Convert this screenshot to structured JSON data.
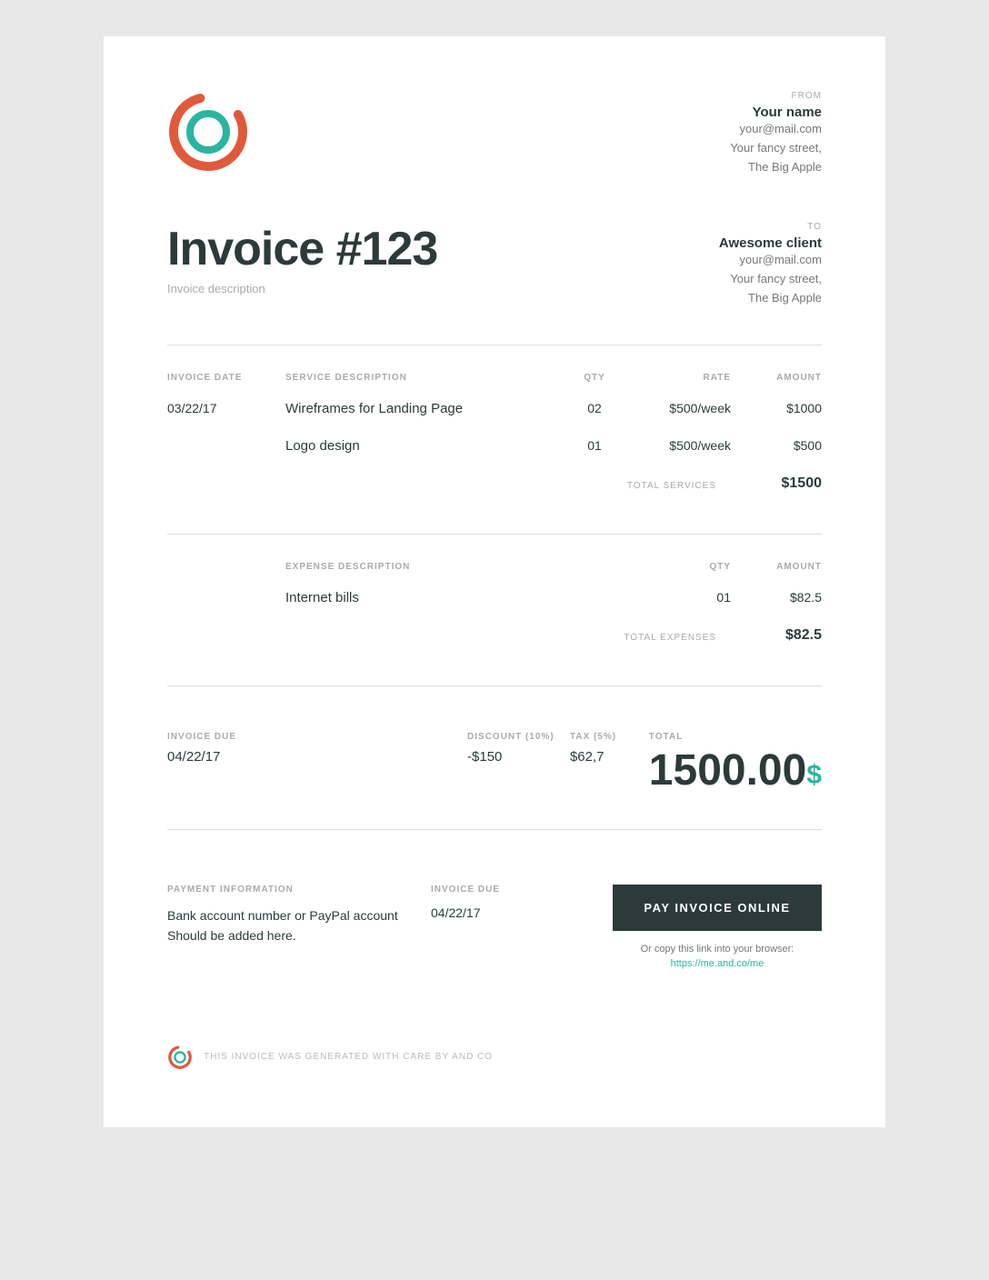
{
  "header": {
    "from_label": "FROM",
    "from_name": "Your name",
    "from_email": "your@mail.com",
    "from_street": "Your fancy street,",
    "from_city": "The Big Apple"
  },
  "invoice": {
    "title": "Invoice #123",
    "description": "Invoice description",
    "to_label": "TO",
    "to_name": "Awesome client",
    "to_email": "your@mail.com",
    "to_street": "Your fancy street,",
    "to_city": "The Big Apple"
  },
  "services": {
    "columns": {
      "invoice_date": "INVOICE DATE",
      "service_desc": "SERVICE DESCRIPTION",
      "qty": "QTY",
      "rate": "RATE",
      "amount": "AMOUNT"
    },
    "invoice_date": "03/22/17",
    "items": [
      {
        "description": "Wireframes for Landing Page",
        "qty": "02",
        "rate": "$500/week",
        "amount": "$1000"
      },
      {
        "description": "Logo design",
        "qty": "01",
        "rate": "$500/week",
        "amount": "$500"
      }
    ],
    "total_label": "TOTAL SERVICES",
    "total_value": "$1500"
  },
  "expenses": {
    "columns": {
      "expense_desc": "EXPENSE DESCRIPTION",
      "qty": "QTY",
      "amount": "AMOUNT"
    },
    "items": [
      {
        "description": "Internet bills",
        "qty": "01",
        "amount": "$82.5"
      }
    ],
    "total_label": "TOTAL EXPENSES",
    "total_value": "$82.5"
  },
  "summary": {
    "invoice_due_label": "INVOICE DUE",
    "invoice_due_date": "04/22/17",
    "discount_label": "DISCOUNT (10%)",
    "discount_value": "-$150",
    "tax_label": "TAX (5%)",
    "tax_value": "$62,7",
    "total_label": "TOTAL",
    "total_integer": "1500.00",
    "total_currency": "$"
  },
  "payment": {
    "info_label": "PAYMENT INFORMATION",
    "info_text_line1": "Bank account number or PayPal account",
    "info_text_line2": "Should be added here.",
    "due_label": "INVOICE DUE",
    "due_date": "04/22/17",
    "pay_button": "PAY INVOICE ONLINE",
    "link_prefix": "Or copy this link into your browser:",
    "link_url": "https://me.and.co/me",
    "link_display": "https://me.and.co/me"
  },
  "footer": {
    "text": "THIS INVOICE WAS GENERATED WITH CARE BY AND CO"
  },
  "colors": {
    "teal": "#2bb5a0",
    "orange_red": "#e05a3a",
    "dark": "#2d3a3a"
  }
}
